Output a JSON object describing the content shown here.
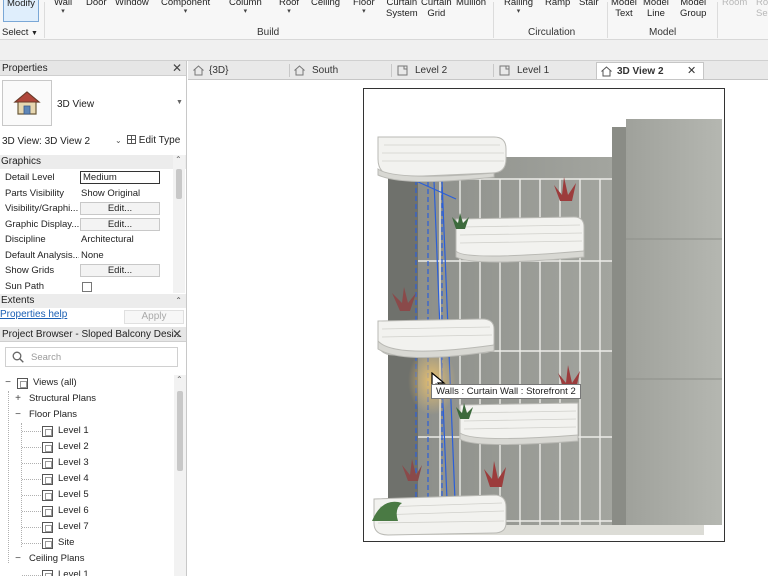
{
  "ribbon": {
    "buttons": {
      "modify": "Modify",
      "wall": "Wall",
      "door": "Door",
      "window": "Window",
      "component": "Component",
      "column": "Column",
      "roof": "Roof",
      "ceiling": "Ceiling",
      "floor": "Floor",
      "curtain_system": "Curtain\nSystem",
      "curtain_grid": "Curtain\nGrid",
      "mullion": "Mullion",
      "railing": "Railing",
      "ramp": "Ramp",
      "stair": "Stair",
      "model_text": "Model\nText",
      "model_line": "Model\nLine",
      "model_group": "Model\nGroup",
      "room": "Room",
      "room_sep": "Ro\nSep"
    },
    "groups": {
      "select": "Select",
      "build": "Build",
      "circulation": "Circulation",
      "model": "Model"
    }
  },
  "properties": {
    "title": "Properties",
    "type_name": "3D View",
    "instance_selector": "3D View: 3D View 2",
    "edit_type": "Edit Type",
    "sections": {
      "graphics": "Graphics",
      "extents": "Extents"
    },
    "rows": [
      {
        "name": "Detail Level",
        "value": "Medium"
      },
      {
        "name": "Parts Visibility",
        "value": "Show Original"
      },
      {
        "name": "Visibility/Graphi...",
        "value": "Edit..."
      },
      {
        "name": "Graphic Display...",
        "value": "Edit..."
      },
      {
        "name": "Discipline",
        "value": "Architectural"
      },
      {
        "name": "Default Analysis...",
        "value": "None"
      },
      {
        "name": "Show Grids",
        "value": "Edit..."
      },
      {
        "name": "Sun Path",
        "value": ""
      }
    ],
    "help_link": "Properties help",
    "apply": "Apply"
  },
  "browser": {
    "title": "Project Browser - Sloped Balcony Desi...",
    "search_placeholder": "Search",
    "tree": {
      "views": "Views (all)",
      "structural_plans": "Structural Plans",
      "floor_plans": "Floor Plans",
      "floor_levels": [
        "Level 1",
        "Level 2",
        "Level 3",
        "Level 4",
        "Level 5",
        "Level 6",
        "Level 7",
        "Site"
      ],
      "ceiling_plans": "Ceiling Plans",
      "ceiling_levels": [
        "Level 1"
      ]
    }
  },
  "tabs": [
    "{3D}",
    "South",
    "Level 2",
    "Level 1",
    "3D View 2"
  ],
  "active_tab": "3D View 2",
  "canvas": {
    "tooltip": "Walls : Curtain Wall : Storefront 2"
  },
  "colors": {
    "accent": "#1a5fb4",
    "selection_blue": "#2b5fd9",
    "facade_gray": "#9a9c96",
    "balcony_white": "#f2f2ef"
  }
}
